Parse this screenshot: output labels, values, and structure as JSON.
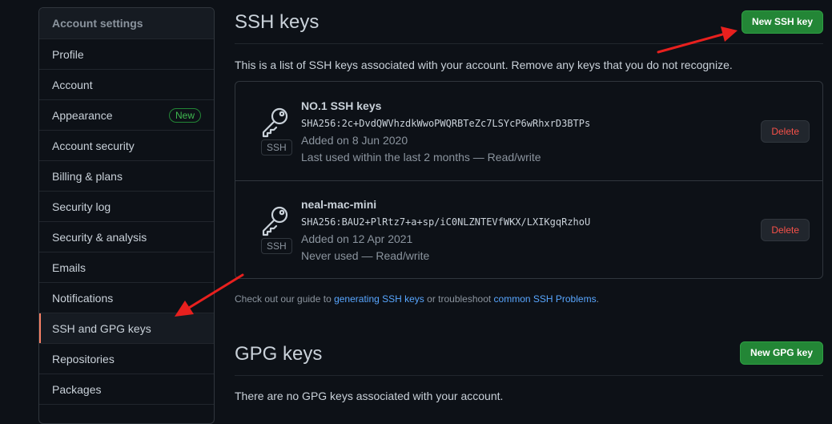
{
  "sidebar": {
    "header": "Account settings",
    "items": [
      {
        "label": "Profile"
      },
      {
        "label": "Account"
      },
      {
        "label": "Appearance",
        "badge": "New"
      },
      {
        "label": "Account security"
      },
      {
        "label": "Billing & plans"
      },
      {
        "label": "Security log"
      },
      {
        "label": "Security & analysis"
      },
      {
        "label": "Emails"
      },
      {
        "label": "Notifications"
      },
      {
        "label": "SSH and GPG keys",
        "active": true
      },
      {
        "label": "Repositories"
      },
      {
        "label": "Packages"
      }
    ]
  },
  "ssh": {
    "title": "SSH keys",
    "new_button": "New SSH key",
    "intro": "This is a list of SSH keys associated with your account. Remove any keys that you do not recognize.",
    "keys": [
      {
        "name": "NO.1 SSH keys",
        "fingerprint": "SHA256:2c+DvdQWVhzdkWwoPWQRBTeZc7LSYcP6wRhxrD3BTPs",
        "added": "Added on 8 Jun 2020",
        "used": "Last used within the last 2 months — Read/write",
        "type": "SSH",
        "delete_label": "Delete"
      },
      {
        "name": "neal-mac-mini",
        "fingerprint": "SHA256:BAU2+PlRtz7+a+sp/iC0NLZNTEVfWKX/LXIKgqRzhoU",
        "added": "Added on 12 Apr 2021",
        "used": "Never used — Read/write",
        "type": "SSH",
        "delete_label": "Delete"
      }
    ],
    "guide": {
      "prefix": "Check out our guide to ",
      "link1": "generating SSH keys",
      "middle": " or troubleshoot ",
      "link2": "common SSH Problems",
      "suffix": "."
    }
  },
  "gpg": {
    "title": "GPG keys",
    "new_button": "New GPG key",
    "empty": "There are no GPG keys associated with your account."
  },
  "colors": {
    "background": "#0d1117",
    "accent_green": "#238636",
    "danger": "#f85149",
    "link": "#58a6ff",
    "active_marker": "#f78166",
    "annotation_arrow": "#e8201e"
  }
}
